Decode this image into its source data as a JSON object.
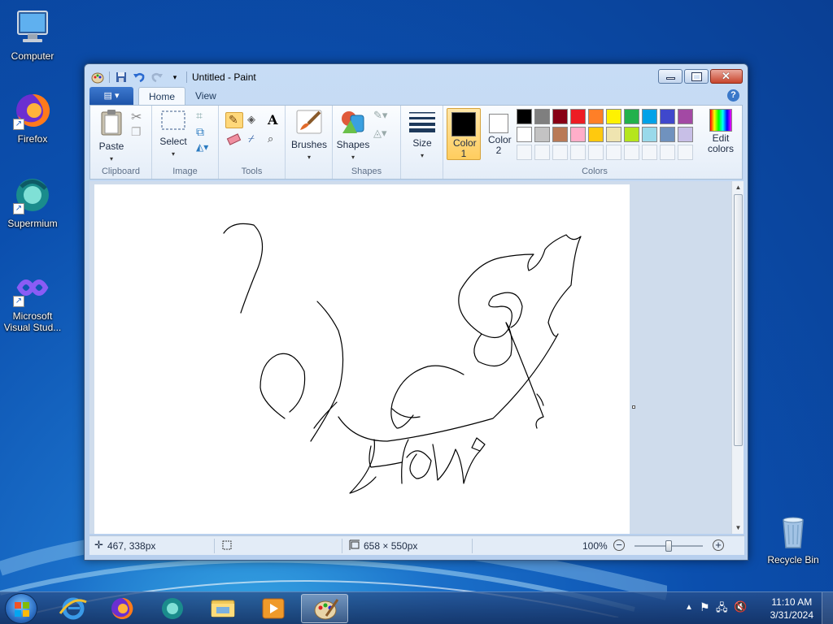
{
  "desktop": {
    "icons": [
      {
        "label": "Computer"
      },
      {
        "label": "Firefox"
      },
      {
        "label": "Supermium"
      },
      {
        "label": "Microsoft Visual Stud..."
      },
      {
        "label": "Recycle Bin"
      }
    ]
  },
  "window": {
    "title": "Untitled - Paint",
    "tabs": {
      "file": "",
      "home": "Home",
      "view": "View"
    },
    "groups": {
      "clipboard": {
        "label": "Clipboard",
        "paste": "Paste"
      },
      "image": {
        "label": "Image",
        "select": "Select"
      },
      "tools": {
        "label": "Tools"
      },
      "brushes": {
        "label": "Brushes"
      },
      "shapes": {
        "label": "Shapes",
        "shapes_btn": "Shapes"
      },
      "size": {
        "label": "Size"
      },
      "colors": {
        "label": "Colors",
        "color1": "Color 1",
        "color2": "Color 2",
        "edit": "Edit colors",
        "color1_value": "#000000",
        "color2_value": "#ffffff",
        "row1": [
          "#000000",
          "#7f7f7f",
          "#880015",
          "#ed1c24",
          "#ff7f27",
          "#fff200",
          "#22b14c",
          "#00a2e8",
          "#3f48cc",
          "#a349a4"
        ],
        "row2": [
          "#ffffff",
          "#c3c3c3",
          "#b97a57",
          "#ffaec9",
          "#ffc90e",
          "#efe4b0",
          "#b5e61d",
          "#99d9ea",
          "#7092be",
          "#c8bfe7"
        ]
      }
    },
    "status": {
      "cursor_pos": "467, 338px",
      "selection_size": "",
      "canvas_size": "658 × 550px",
      "zoom": "100%",
      "zoom_fraction": 0.5
    }
  },
  "taskbar": {
    "clock_time": "11:10 AM",
    "clock_date": "3/31/2024",
    "apps": [
      "internet-explorer",
      "firefox",
      "supermium",
      "file-explorer",
      "media-player",
      "paint"
    ]
  }
}
